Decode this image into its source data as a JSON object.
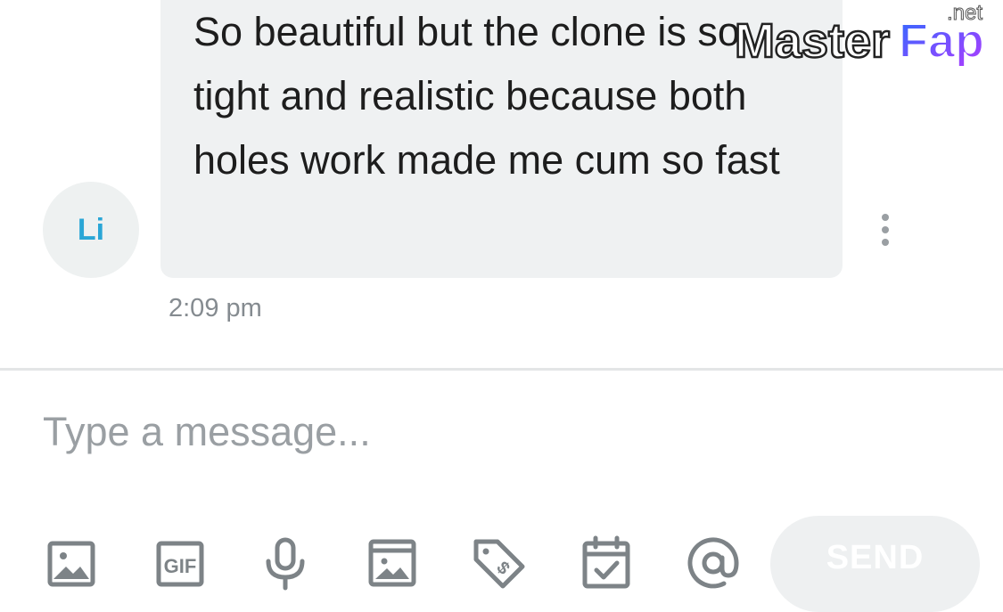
{
  "message": {
    "avatar_initials": "Li",
    "text": "So beautiful but the clone is so tight and realistic because both holes work made me cum so fast",
    "time": "2:09 pm",
    "more_icon": "more-vertical-icon"
  },
  "composer": {
    "placeholder": "Type a message...",
    "value": ""
  },
  "toolbar": {
    "icons": [
      "image-icon",
      "gif-icon",
      "microphone-icon",
      "gallery-icon",
      "price-tag-icon",
      "calendar-icon",
      "at-sign-icon"
    ],
    "send_label": "SEND"
  },
  "watermark": {
    "brand": "MasterFap",
    "tld": ".net"
  },
  "colors": {
    "avatar_text": "#2aa6d6",
    "bubble_bg": "#eff1f2",
    "icon_gray": "#7d8387",
    "send_bg": "#eef0f1"
  }
}
